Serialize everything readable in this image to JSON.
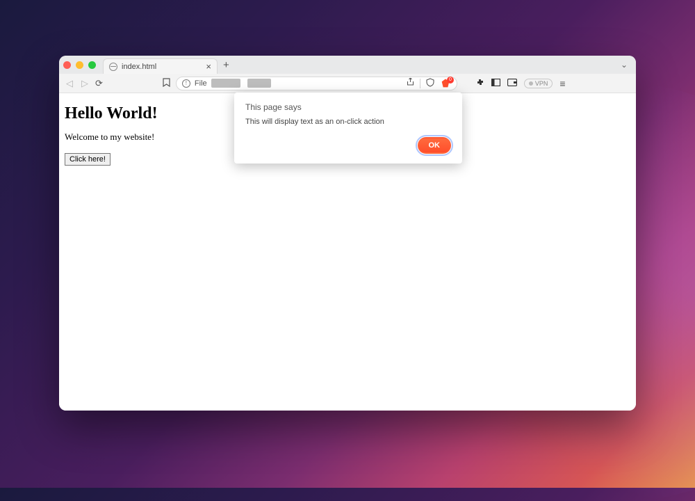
{
  "tab": {
    "title": "index.html"
  },
  "urlbar": {
    "scheme_label": "File"
  },
  "brave": {
    "badge_count": "0"
  },
  "vpn": {
    "label": "VPN"
  },
  "page": {
    "heading": "Hello World!",
    "welcome": "Welcome to my website!",
    "button_label": "Click here!"
  },
  "alert": {
    "title": "This page says",
    "message": "This will display text as an on-click action",
    "ok": "OK"
  }
}
